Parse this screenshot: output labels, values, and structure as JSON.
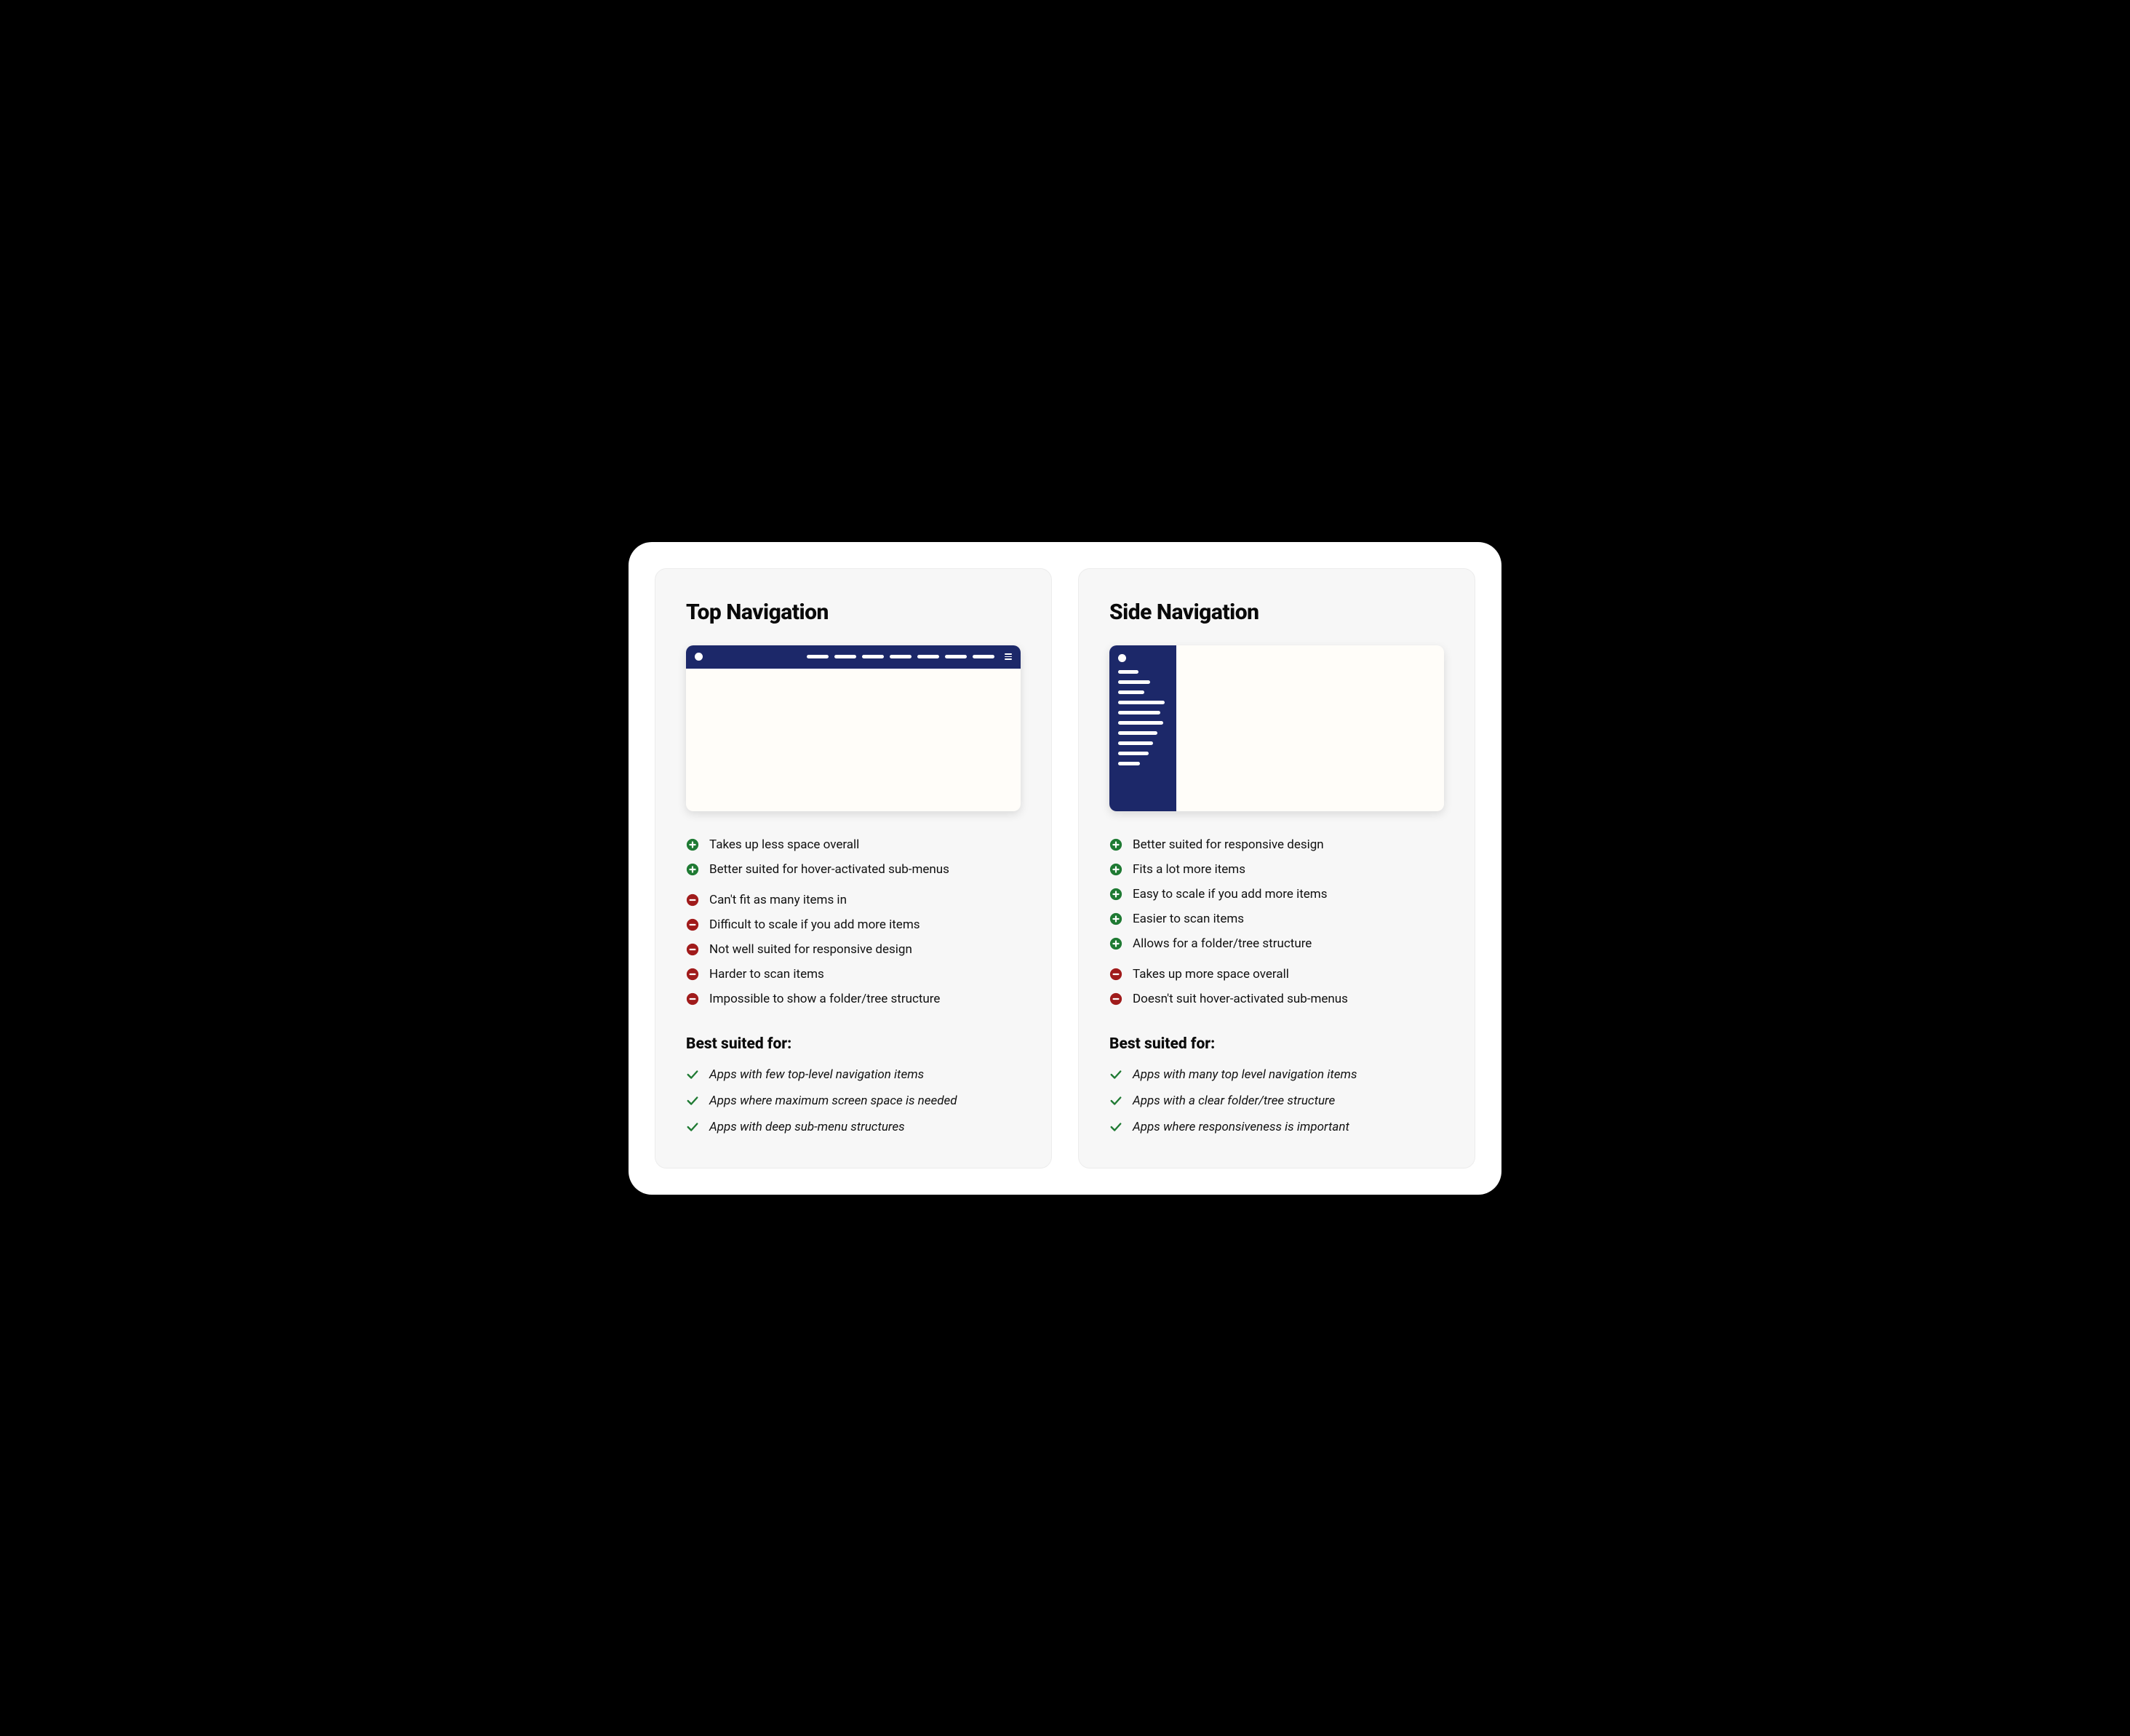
{
  "colors": {
    "nav_bg": "#1c2869",
    "card_bg": "#f7f7f7",
    "pro_icon": "#1f7a33",
    "con_icon": "#a01b1b"
  },
  "left": {
    "title": "Top Navigation",
    "pros": [
      "Takes up less space overall",
      "Better suited for hover-activated sub-menus"
    ],
    "cons": [
      "Can't fit as many items in",
      "Difficult to scale if you add more items",
      "Not well suited for responsive design",
      "Harder to scan items",
      "Impossible to show a folder/tree structure"
    ],
    "best_heading": "Best suited for:",
    "best": [
      "Apps with few top-level navigation items",
      "Apps where maximum screen space is needed",
      "Apps with deep sub-menu structures"
    ]
  },
  "right": {
    "title": "Side Navigation",
    "pros": [
      "Better suited for responsive design",
      "Fits a lot more items",
      "Easy to scale if you add more items",
      "Easier to scan items",
      "Allows for a folder/tree structure"
    ],
    "cons": [
      "Takes up more space overall",
      "Doesn't suit hover-activated sub-menus"
    ],
    "best_heading": "Best suited for:",
    "best": [
      "Apps with many top level navigation items",
      "Apps with a clear folder/tree structure",
      "Apps where responsiveness is important"
    ]
  }
}
